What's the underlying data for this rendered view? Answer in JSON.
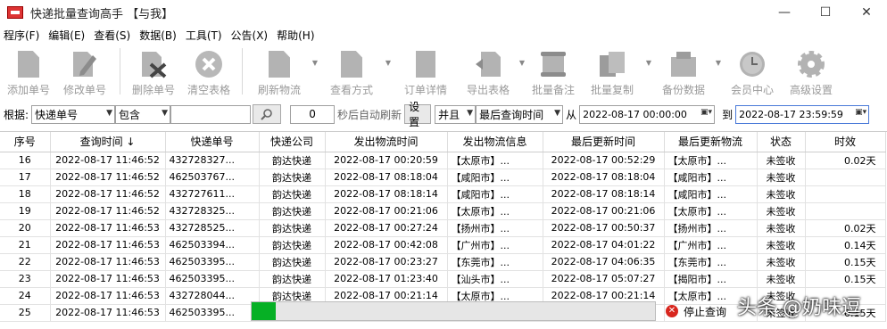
{
  "window": {
    "title": "快递批量查询高手 【与我】",
    "min": "—",
    "max": "☐",
    "close": "✕"
  },
  "menu": [
    "程序(F)",
    "编辑(E)",
    "查看(S)",
    "数据(B)",
    "工具(T)",
    "公告(X)",
    "帮助(H)"
  ],
  "toolbar": {
    "add": "添加单号",
    "edit": "修改单号",
    "delete": "删除单号",
    "clear": "清空表格",
    "refresh": "刷新物流",
    "view": "查看方式",
    "detail": "订单详情",
    "export": "导出表格",
    "batch_note": "批量备注",
    "batch_copy": "批量复制",
    "backup": "备份数据",
    "member": "会员中心",
    "settings": "高级设置"
  },
  "filter": {
    "by_label": "根据:",
    "field": "快递单号",
    "mode": "包含",
    "keyword": "",
    "search_icon": "search-icon",
    "seconds": "0",
    "auto_refresh_label": "秒后自动刷新",
    "set_button": "设置",
    "logic": "并且",
    "date_field": "最后查询时间",
    "from_label": "从",
    "from": "2022-08-17 00:00:00",
    "to_label": "到",
    "to": "2022-08-17 23:59:59"
  },
  "table": {
    "columns": [
      "序号",
      "查询时间 ↓",
      "快递单号",
      "快递公司",
      "发出物流时间",
      "发出物流信息",
      "最后更新时间",
      "最后更新物流",
      "状态",
      "时效"
    ],
    "rows": [
      [
        "16",
        "2022-08-17 11:46:52",
        "432728327...",
        "韵达快递",
        "2022-08-17 00:20:59",
        "【太原市】...",
        "2022-08-17 00:52:29",
        "【太原市】...",
        "未签收",
        "0.02天"
      ],
      [
        "17",
        "2022-08-17 11:46:52",
        "462503767...",
        "韵达快递",
        "2022-08-17 08:18:04",
        "【咸阳市】...",
        "2022-08-17 08:18:04",
        "【咸阳市】...",
        "未签收",
        ""
      ],
      [
        "18",
        "2022-08-17 11:46:52",
        "432727611...",
        "韵达快递",
        "2022-08-17 08:18:14",
        "【咸阳市】...",
        "2022-08-17 08:18:14",
        "【咸阳市】...",
        "未签收",
        ""
      ],
      [
        "19",
        "2022-08-17 11:46:52",
        "432728325...",
        "韵达快递",
        "2022-08-17 00:21:06",
        "【太原市】...",
        "2022-08-17 00:21:06",
        "【太原市】...",
        "未签收",
        ""
      ],
      [
        "20",
        "2022-08-17 11:46:53",
        "432728525...",
        "韵达快递",
        "2022-08-17 00:27:24",
        "【扬州市】...",
        "2022-08-17 00:50:37",
        "【扬州市】...",
        "未签收",
        "0.02天"
      ],
      [
        "21",
        "2022-08-17 11:46:53",
        "462503394...",
        "韵达快递",
        "2022-08-17 00:42:08",
        "【广州市】...",
        "2022-08-17 04:01:22",
        "【广州市】...",
        "未签收",
        "0.14天"
      ],
      [
        "22",
        "2022-08-17 11:46:53",
        "462503395...",
        "韵达快递",
        "2022-08-17 00:23:27",
        "【东莞市】...",
        "2022-08-17 04:06:35",
        "【东莞市】...",
        "未签收",
        "0.15天"
      ],
      [
        "23",
        "2022-08-17 11:46:53",
        "462503395...",
        "韵达快递",
        "2022-08-17 01:23:40",
        "【汕头市】...",
        "2022-08-17 05:07:27",
        "【揭阳市】...",
        "未签收",
        "0.15天"
      ],
      [
        "24",
        "2022-08-17 11:46:53",
        "432728044...",
        "韵达快递",
        "2022-08-17 00:21:14",
        "【太原市】...",
        "2022-08-17 00:21:14",
        "【太原市】...",
        "未签收",
        ""
      ],
      [
        "25",
        "2022-08-17 11:46:53",
        "462503395...",
        "",
        "",
        "",
        "",
        "",
        "未签收",
        "0.15天"
      ]
    ]
  },
  "progress": {
    "value": 0.06
  },
  "stop_query": "停止查询",
  "watermark": "头条 @奶味逗"
}
